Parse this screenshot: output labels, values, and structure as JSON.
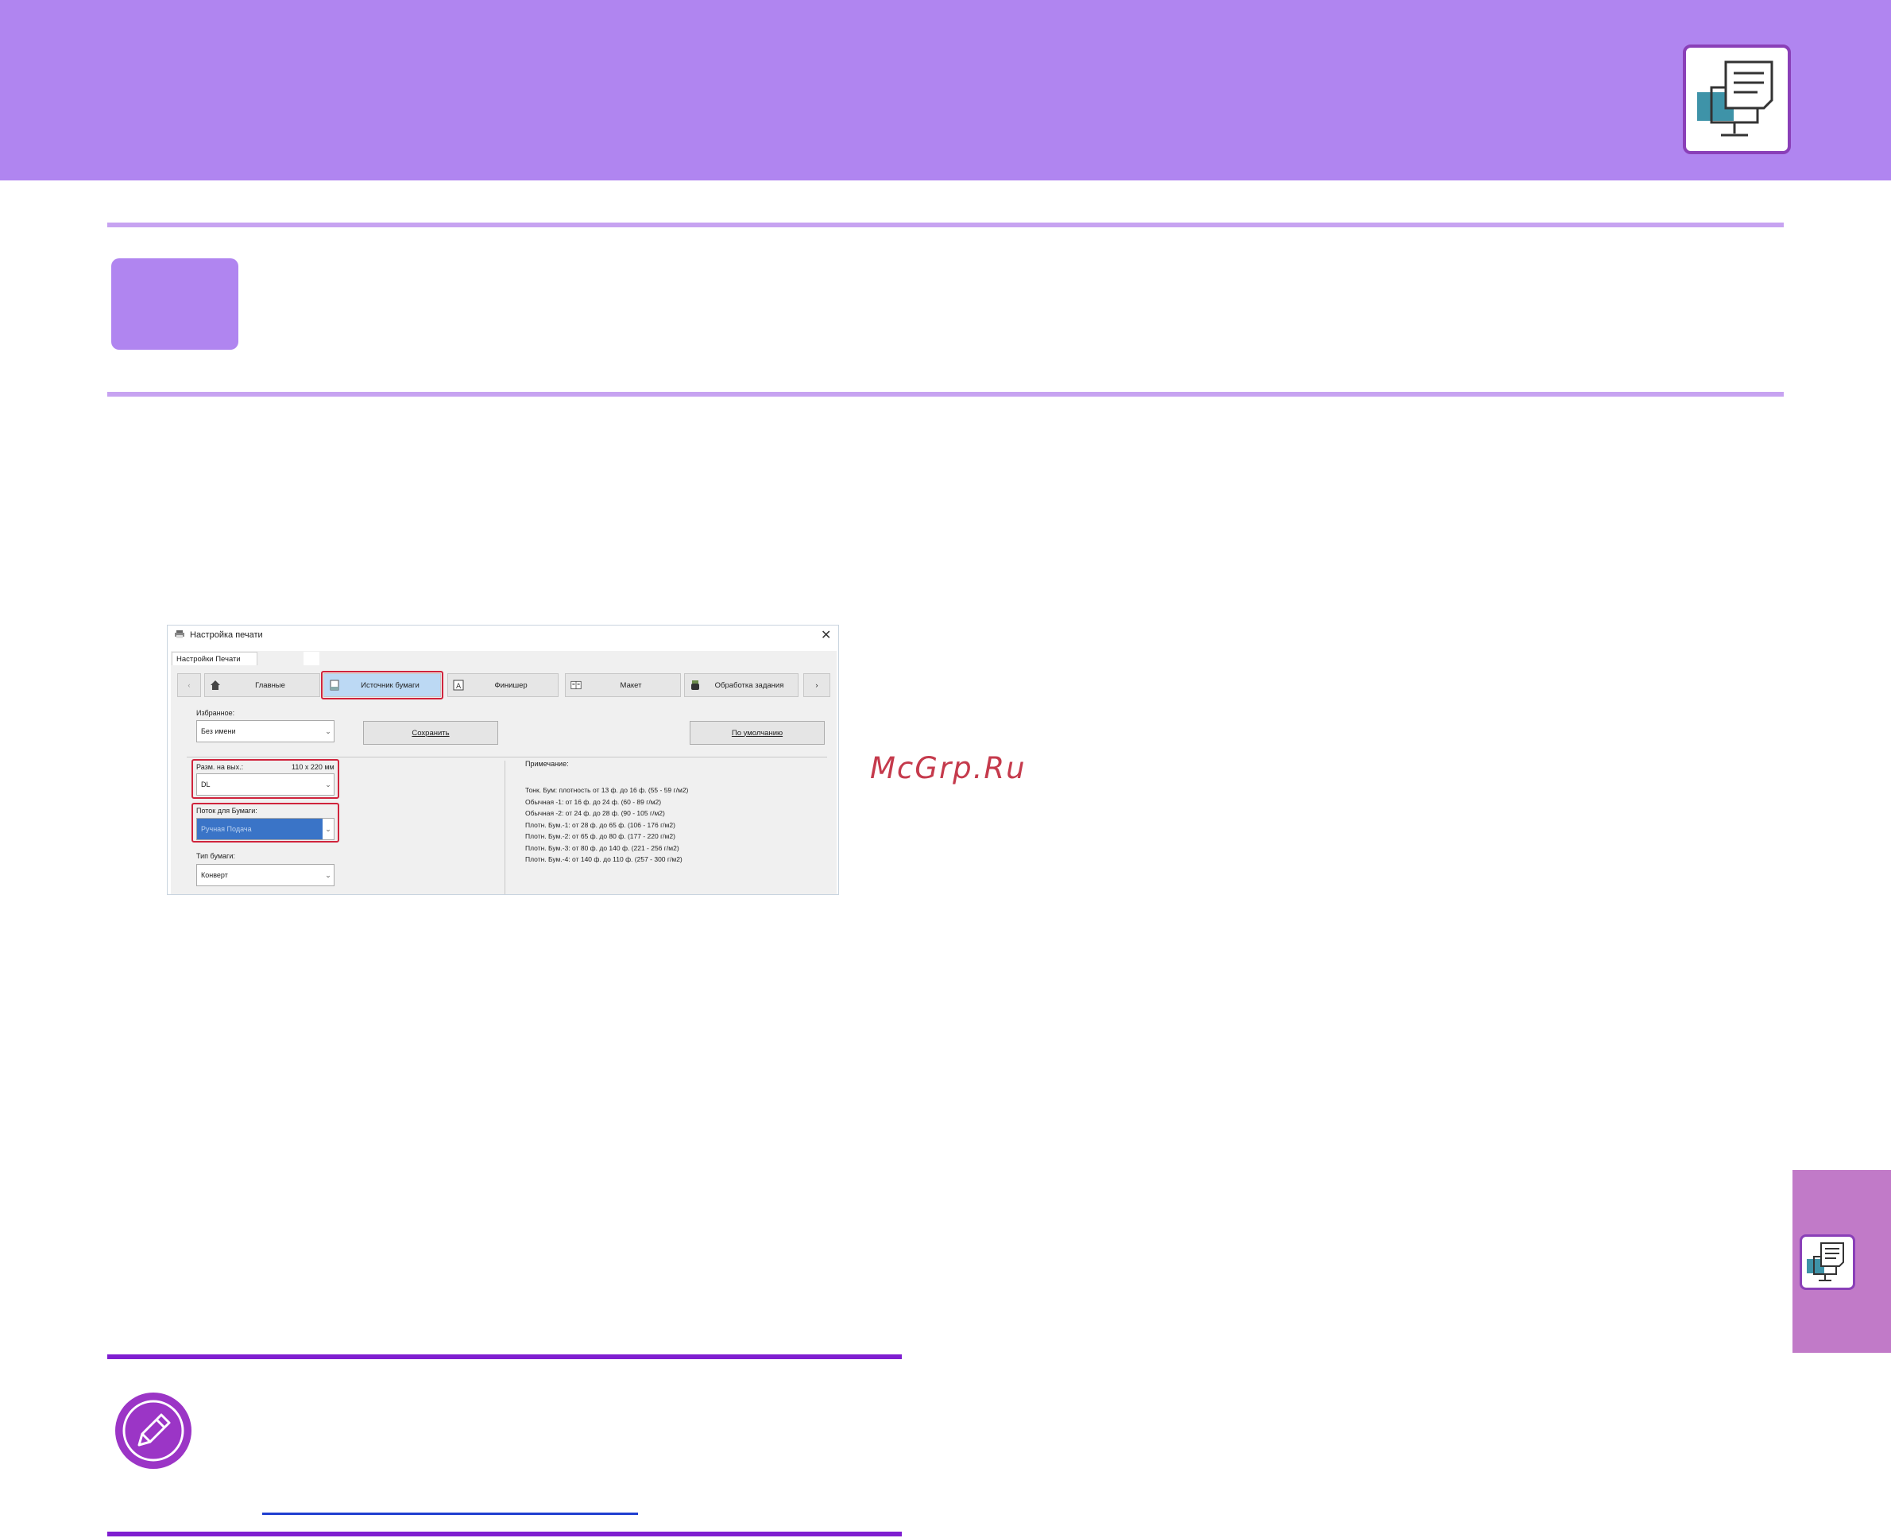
{
  "page": {
    "watermark": "McGrp.Ru"
  },
  "dialog": {
    "title": "Настройка печати",
    "close_glyph": "✕",
    "tab_label": "Настройки Печати",
    "nav": {
      "prev": "‹",
      "next": "›",
      "main": "Главные",
      "paper_source": "Источник бумаги",
      "finisher": "Финишер",
      "layout": "Макет",
      "job_handling": "Обработка задания"
    },
    "favorites": {
      "label": "Избранное:",
      "value": "Без имени"
    },
    "save_label": "Сохранить",
    "default_label": "По умолчанию",
    "output_size": {
      "label": "Разм. на вых.:",
      "dimensions": "110 x 220 мм",
      "value": "DL"
    },
    "paper_tray": {
      "label": "Поток для Бумаги:",
      "value": "Ручная Подача"
    },
    "paper_type": {
      "label": "Тип бумаги:",
      "value": "Конверт"
    },
    "notes": {
      "title": "Примечание:",
      "lines": [
        "Тонк. Бум: плотность от 13 ф. до 16 ф. (55 - 59 г/м2)",
        "Обычная -1: от 16 ф. до 24 ф. (60 - 89 г/м2)",
        "Обычная -2: от 24 ф. до 28 ф. (90 - 105 г/м2)",
        "Плотн. Бум.-1: от 28 ф. до 65 ф. (106 - 176 г/м2)",
        "Плотн. Бум.-2: от 65 ф. до 80 ф. (177 - 220 г/м2)",
        "Плотн. Бум.-3: от 80 ф. до 140 ф. (221 - 256 г/м2)",
        "Плотн. Бум.-4: от 140 ф. до 110 ф. (257 - 300 г/м2)"
      ]
    }
  },
  "icons": {
    "banner": "printer-computer-icon",
    "side_tab": "printer-computer-icon",
    "note": "pencil-icon",
    "home": "home-icon",
    "paper_source": "paper-tray-icon",
    "finisher": "finisher-icon",
    "layout": "layout-icon",
    "job": "job-handling-icon"
  },
  "colors": {
    "banner": "#b085f0",
    "accent_purple": "#7f1ed0",
    "highlight_red": "#d0243c",
    "selected_blue": "#3a74c7",
    "side_tab": "#c17ac8"
  }
}
